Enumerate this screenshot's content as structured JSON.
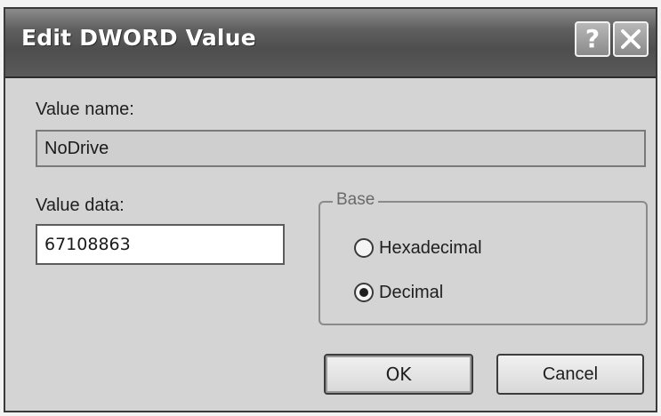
{
  "window": {
    "title": "Edit DWORD Value",
    "help_label": "?",
    "close_icon": "close-icon"
  },
  "value_name": {
    "label": "Value name:",
    "value": "NoDrive"
  },
  "value_data": {
    "label": "Value data:",
    "value": "67108863"
  },
  "base": {
    "legend": "Base",
    "options": [
      {
        "label": "Hexadecimal",
        "selected": false
      },
      {
        "label": "Decimal",
        "selected": true
      }
    ]
  },
  "buttons": {
    "ok_label": "OK",
    "cancel_label": "Cancel"
  }
}
